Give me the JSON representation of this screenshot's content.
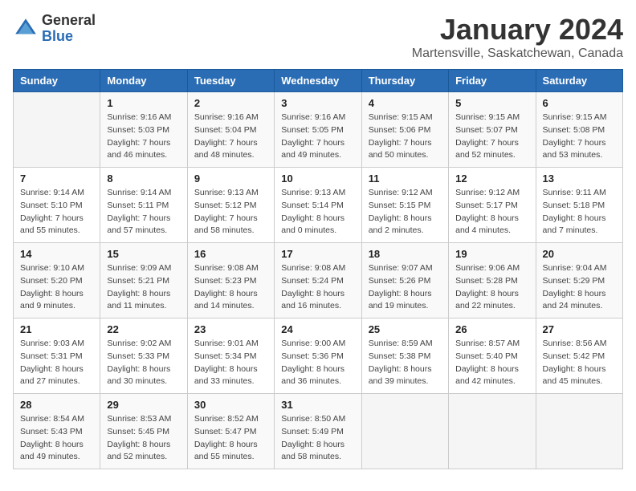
{
  "header": {
    "logo_general": "General",
    "logo_blue": "Blue",
    "title": "January 2024",
    "subtitle": "Martensville, Saskatchewan, Canada"
  },
  "weekdays": [
    "Sunday",
    "Monday",
    "Tuesday",
    "Wednesday",
    "Thursday",
    "Friday",
    "Saturday"
  ],
  "weeks": [
    [
      {
        "day": "",
        "sunrise": "",
        "sunset": "",
        "daylight": ""
      },
      {
        "day": "1",
        "sunrise": "Sunrise: 9:16 AM",
        "sunset": "Sunset: 5:03 PM",
        "daylight": "Daylight: 7 hours and 46 minutes."
      },
      {
        "day": "2",
        "sunrise": "Sunrise: 9:16 AM",
        "sunset": "Sunset: 5:04 PM",
        "daylight": "Daylight: 7 hours and 48 minutes."
      },
      {
        "day": "3",
        "sunrise": "Sunrise: 9:16 AM",
        "sunset": "Sunset: 5:05 PM",
        "daylight": "Daylight: 7 hours and 49 minutes."
      },
      {
        "day": "4",
        "sunrise": "Sunrise: 9:15 AM",
        "sunset": "Sunset: 5:06 PM",
        "daylight": "Daylight: 7 hours and 50 minutes."
      },
      {
        "day": "5",
        "sunrise": "Sunrise: 9:15 AM",
        "sunset": "Sunset: 5:07 PM",
        "daylight": "Daylight: 7 hours and 52 minutes."
      },
      {
        "day": "6",
        "sunrise": "Sunrise: 9:15 AM",
        "sunset": "Sunset: 5:08 PM",
        "daylight": "Daylight: 7 hours and 53 minutes."
      }
    ],
    [
      {
        "day": "7",
        "sunrise": "Sunrise: 9:14 AM",
        "sunset": "Sunset: 5:10 PM",
        "daylight": "Daylight: 7 hours and 55 minutes."
      },
      {
        "day": "8",
        "sunrise": "Sunrise: 9:14 AM",
        "sunset": "Sunset: 5:11 PM",
        "daylight": "Daylight: 7 hours and 57 minutes."
      },
      {
        "day": "9",
        "sunrise": "Sunrise: 9:13 AM",
        "sunset": "Sunset: 5:12 PM",
        "daylight": "Daylight: 7 hours and 58 minutes."
      },
      {
        "day": "10",
        "sunrise": "Sunrise: 9:13 AM",
        "sunset": "Sunset: 5:14 PM",
        "daylight": "Daylight: 8 hours and 0 minutes."
      },
      {
        "day": "11",
        "sunrise": "Sunrise: 9:12 AM",
        "sunset": "Sunset: 5:15 PM",
        "daylight": "Daylight: 8 hours and 2 minutes."
      },
      {
        "day": "12",
        "sunrise": "Sunrise: 9:12 AM",
        "sunset": "Sunset: 5:17 PM",
        "daylight": "Daylight: 8 hours and 4 minutes."
      },
      {
        "day": "13",
        "sunrise": "Sunrise: 9:11 AM",
        "sunset": "Sunset: 5:18 PM",
        "daylight": "Daylight: 8 hours and 7 minutes."
      }
    ],
    [
      {
        "day": "14",
        "sunrise": "Sunrise: 9:10 AM",
        "sunset": "Sunset: 5:20 PM",
        "daylight": "Daylight: 8 hours and 9 minutes."
      },
      {
        "day": "15",
        "sunrise": "Sunrise: 9:09 AM",
        "sunset": "Sunset: 5:21 PM",
        "daylight": "Daylight: 8 hours and 11 minutes."
      },
      {
        "day": "16",
        "sunrise": "Sunrise: 9:08 AM",
        "sunset": "Sunset: 5:23 PM",
        "daylight": "Daylight: 8 hours and 14 minutes."
      },
      {
        "day": "17",
        "sunrise": "Sunrise: 9:08 AM",
        "sunset": "Sunset: 5:24 PM",
        "daylight": "Daylight: 8 hours and 16 minutes."
      },
      {
        "day": "18",
        "sunrise": "Sunrise: 9:07 AM",
        "sunset": "Sunset: 5:26 PM",
        "daylight": "Daylight: 8 hours and 19 minutes."
      },
      {
        "day": "19",
        "sunrise": "Sunrise: 9:06 AM",
        "sunset": "Sunset: 5:28 PM",
        "daylight": "Daylight: 8 hours and 22 minutes."
      },
      {
        "day": "20",
        "sunrise": "Sunrise: 9:04 AM",
        "sunset": "Sunset: 5:29 PM",
        "daylight": "Daylight: 8 hours and 24 minutes."
      }
    ],
    [
      {
        "day": "21",
        "sunrise": "Sunrise: 9:03 AM",
        "sunset": "Sunset: 5:31 PM",
        "daylight": "Daylight: 8 hours and 27 minutes."
      },
      {
        "day": "22",
        "sunrise": "Sunrise: 9:02 AM",
        "sunset": "Sunset: 5:33 PM",
        "daylight": "Daylight: 8 hours and 30 minutes."
      },
      {
        "day": "23",
        "sunrise": "Sunrise: 9:01 AM",
        "sunset": "Sunset: 5:34 PM",
        "daylight": "Daylight: 8 hours and 33 minutes."
      },
      {
        "day": "24",
        "sunrise": "Sunrise: 9:00 AM",
        "sunset": "Sunset: 5:36 PM",
        "daylight": "Daylight: 8 hours and 36 minutes."
      },
      {
        "day": "25",
        "sunrise": "Sunrise: 8:59 AM",
        "sunset": "Sunset: 5:38 PM",
        "daylight": "Daylight: 8 hours and 39 minutes."
      },
      {
        "day": "26",
        "sunrise": "Sunrise: 8:57 AM",
        "sunset": "Sunset: 5:40 PM",
        "daylight": "Daylight: 8 hours and 42 minutes."
      },
      {
        "day": "27",
        "sunrise": "Sunrise: 8:56 AM",
        "sunset": "Sunset: 5:42 PM",
        "daylight": "Daylight: 8 hours and 45 minutes."
      }
    ],
    [
      {
        "day": "28",
        "sunrise": "Sunrise: 8:54 AM",
        "sunset": "Sunset: 5:43 PM",
        "daylight": "Daylight: 8 hours and 49 minutes."
      },
      {
        "day": "29",
        "sunrise": "Sunrise: 8:53 AM",
        "sunset": "Sunset: 5:45 PM",
        "daylight": "Daylight: 8 hours and 52 minutes."
      },
      {
        "day": "30",
        "sunrise": "Sunrise: 8:52 AM",
        "sunset": "Sunset: 5:47 PM",
        "daylight": "Daylight: 8 hours and 55 minutes."
      },
      {
        "day": "31",
        "sunrise": "Sunrise: 8:50 AM",
        "sunset": "Sunset: 5:49 PM",
        "daylight": "Daylight: 8 hours and 58 minutes."
      },
      {
        "day": "",
        "sunrise": "",
        "sunset": "",
        "daylight": ""
      },
      {
        "day": "",
        "sunrise": "",
        "sunset": "",
        "daylight": ""
      },
      {
        "day": "",
        "sunrise": "",
        "sunset": "",
        "daylight": ""
      }
    ]
  ]
}
